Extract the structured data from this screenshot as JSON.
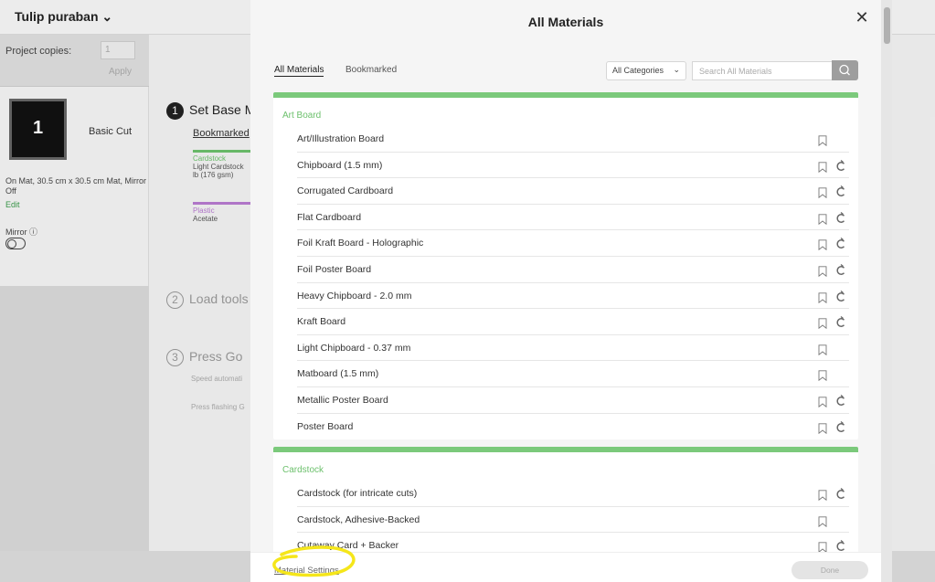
{
  "app": {
    "project_title": "Tulip puraban",
    "copies_label": "Project copies:",
    "copies_value": "1",
    "apply_label": "Apply",
    "mat_number": "1",
    "mat_caption": "Basic Cut",
    "mat_info": "On Mat, 30.5 cm x 30.5 cm Mat, Mirror Off",
    "edit_label": "Edit",
    "mirror_label": "Mirror",
    "steps": [
      {
        "num": "1",
        "label": "Set Base M"
      },
      {
        "num": "2",
        "label": "Load tools"
      },
      {
        "num": "3",
        "label": "Press Go"
      }
    ],
    "bookmarked_link": "Bookmarked",
    "bg_cards": [
      {
        "category": "Cardstock",
        "desc": "Light Cardstock lb (176 gsm)"
      },
      {
        "category": "Plastic",
        "desc": "Acetate"
      }
    ],
    "speed_text": "Speed automati",
    "press_flashing_text": "Press flashing G"
  },
  "modal": {
    "title": "All Materials",
    "tabs": [
      {
        "label": "All Materials",
        "active": true
      },
      {
        "label": "Bookmarked",
        "active": false
      }
    ],
    "category_select": "All Categories",
    "search_placeholder": "Search All Materials",
    "sections": [
      {
        "title": "Art Board",
        "items": [
          {
            "label": "Art/Illustration Board",
            "cricut": false
          },
          {
            "label": "Chipboard (1.5 mm)",
            "cricut": true
          },
          {
            "label": "Corrugated Cardboard",
            "cricut": true
          },
          {
            "label": "Flat Cardboard",
            "cricut": true
          },
          {
            "label": "Foil Kraft Board  - Holographic",
            "cricut": true
          },
          {
            "label": "Foil Poster Board",
            "cricut": true
          },
          {
            "label": "Heavy Chipboard - 2.0 mm",
            "cricut": true
          },
          {
            "label": "Kraft Board",
            "cricut": true
          },
          {
            "label": "Light Chipboard - 0.37 mm",
            "cricut": false
          },
          {
            "label": "Matboard (1.5 mm)",
            "cricut": false
          },
          {
            "label": "Metallic Poster Board",
            "cricut": true
          },
          {
            "label": "Poster Board",
            "cricut": true
          }
        ]
      },
      {
        "title": "Cardstock",
        "items": [
          {
            "label": "Cardstock (for intricate cuts)",
            "cricut": true
          },
          {
            "label": "Cardstock, Adhesive-Backed",
            "cricut": false
          },
          {
            "label": "Cutaway Card + Backer",
            "cricut": true
          }
        ]
      }
    ],
    "footer": {
      "settings_link": "Material Settings",
      "done_label": "Done"
    }
  },
  "colors": {
    "accent_green": "#7bc97b",
    "highlight_yellow": "#f5e61a",
    "plastic_purple": "#b77ad0"
  }
}
